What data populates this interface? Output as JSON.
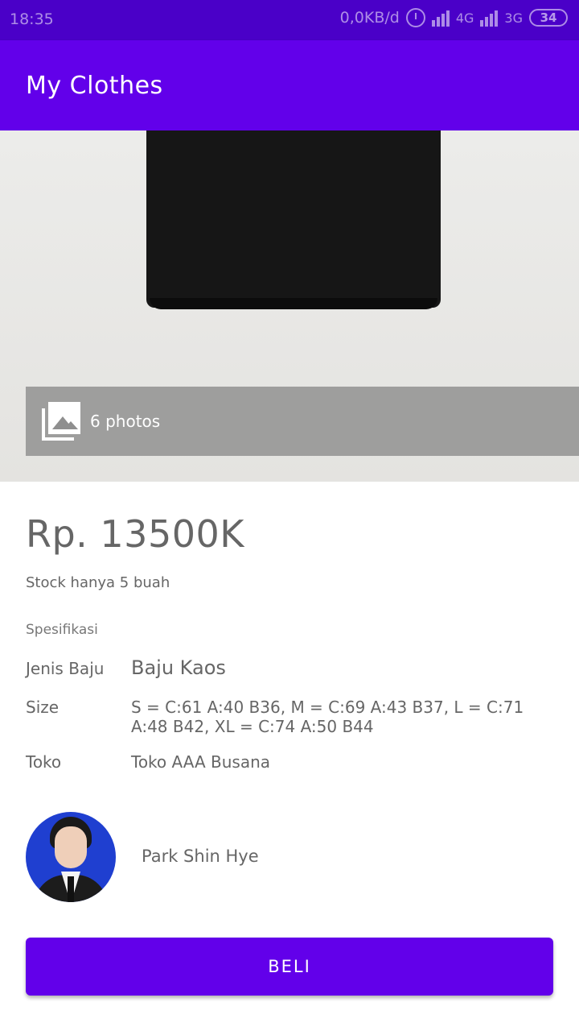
{
  "status_bar": {
    "time": "18:35",
    "speed": "0,0KB/d",
    "network1": "4G",
    "network2": "3G",
    "battery": "34"
  },
  "app_bar": {
    "title": "My Clothes"
  },
  "hero": {
    "photos_label": "6 photos",
    "icon": "gallery-icon"
  },
  "product": {
    "price": "Rp. 13500K",
    "stock": "Stock hanya 5 buah",
    "spec_heading": "Spesifikasi",
    "specs": [
      {
        "label": "Jenis Baju",
        "value": "Baju Kaos"
      },
      {
        "label": "Size",
        "value": "S = C:61 A:40 B36, M = C:69 A:43 B37, L = C:71 A:48 B42, XL = C:74 A:50 B44"
      },
      {
        "label": "Toko",
        "value": "Toko AAA Busana"
      }
    ]
  },
  "seller": {
    "name": "Park Shin Hye"
  },
  "buy_button": {
    "label": "BELI"
  },
  "colors": {
    "primary": "#6200ea",
    "status_bar": "#4a00c8",
    "text": "#666666"
  }
}
